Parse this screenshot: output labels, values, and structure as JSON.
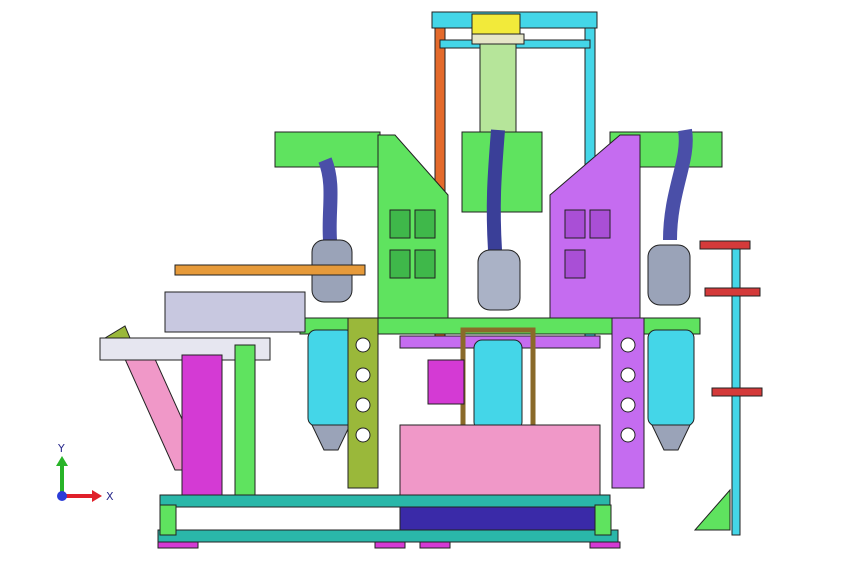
{
  "viewport": {
    "background": "#ffffff"
  },
  "triad": {
    "x_label": "X",
    "y_label": "Y",
    "x_color": "#e0202a",
    "y_color": "#28b428",
    "z_color": "#2a3cd8"
  },
  "palette": {
    "green": "#5fe35f",
    "purple": "#c56cf0",
    "cyan": "#44d6e8",
    "teal": "#2ab7a9",
    "steel": "#9aa3b8",
    "navy": "#2a2a8c",
    "orange": "#e46a2b",
    "yellow": "#f2ea3a",
    "pink": "#f098c8",
    "magenta": "#d43ad4",
    "olive": "#9ab83a"
  }
}
